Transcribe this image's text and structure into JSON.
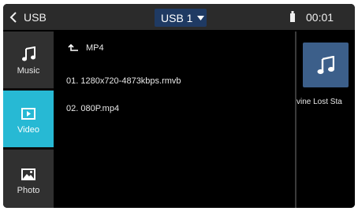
{
  "header": {
    "back_label": "USB",
    "source_label": "USB 1",
    "time": "00:01"
  },
  "sidebar": {
    "items": [
      {
        "label": "Music",
        "icon": "music-note-icon"
      },
      {
        "label": "Video",
        "icon": "video-icon",
        "active": true
      },
      {
        "label": "Photo",
        "icon": "photo-icon"
      }
    ]
  },
  "filelist": {
    "folder": "MP4",
    "files": [
      "01. 1280x720-4873kbps.rmvb",
      "02. 080P.mp4"
    ]
  },
  "preview": {
    "title": "vine Lost Sta"
  },
  "colors": {
    "accent": "#27b9d4",
    "source_bg": "#1f3a63",
    "thumb_bg": "#3c5f8a"
  }
}
